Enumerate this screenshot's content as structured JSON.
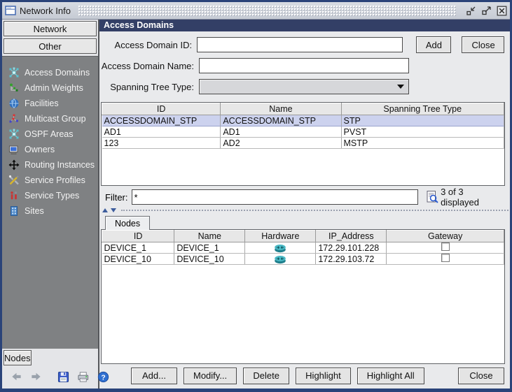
{
  "window": {
    "title": "Network Info"
  },
  "colors": {
    "frame_border": "#2a4379",
    "titlebar_bg": "#ccd1d9",
    "panel_header_bg": "#333f66",
    "sidebar_list_bg": "#7f8183",
    "selected_row_bg": "#ccd2ee",
    "router_icon_teal": "#49b8c4"
  },
  "sidebar": {
    "network_button": "Network",
    "other_button": "Other",
    "items": [
      {
        "label": "Access Domains",
        "icon": "network-hub-icon"
      },
      {
        "label": "Admin Weights",
        "icon": "weights-tree-icon"
      },
      {
        "label": "Facilities",
        "icon": "globe-icon"
      },
      {
        "label": "Multicast Group",
        "icon": "multicast-nodes-icon"
      },
      {
        "label": "OSPF Areas",
        "icon": "network-hub-icon"
      },
      {
        "label": "Owners",
        "icon": "computer-icon"
      },
      {
        "label": "Routing Instances",
        "icon": "cross-arrows-icon"
      },
      {
        "label": "Service Profiles",
        "icon": "tools-icon"
      },
      {
        "label": "Service Types",
        "icon": "service-type-icon"
      },
      {
        "label": "Sites",
        "icon": "building-icon"
      }
    ],
    "nodes_button": "Nodes"
  },
  "main": {
    "header": "Access Domains",
    "form": {
      "id_label": "Access Domain ID:",
      "id_value": "",
      "name_label": "Access Domain Name:",
      "name_value": "",
      "stp_label": "Spanning Tree Type:",
      "stp_value": "",
      "add_button": "Add",
      "close_button": "Close"
    },
    "domains_table": {
      "columns": [
        "ID",
        "Name",
        "Spanning Tree Type"
      ],
      "rows": [
        [
          "ACCESSDOMAIN_STP",
          "ACCESSDOMAIN_STP",
          "STP"
        ],
        [
          "AD1",
          "AD1",
          "PVST"
        ],
        [
          "123",
          "AD2",
          "MSTP"
        ]
      ],
      "selected_row_index": 0
    },
    "filter": {
      "label": "Filter:",
      "value": "*",
      "status": "3 of 3 displayed"
    },
    "nodes_panel": {
      "tab_label": "Nodes",
      "columns": [
        "ID",
        "Name",
        "Hardware",
        "IP_Address",
        "Gateway"
      ],
      "rows": [
        {
          "id": "DEVICE_1",
          "name": "DEVICE_1",
          "hardware": "router-icon",
          "ip": "172.29.101.228",
          "gateway_checked": false
        },
        {
          "id": "DEVICE_10",
          "name": "DEVICE_10",
          "hardware": "router-icon",
          "ip": "172.29.103.72",
          "gateway_checked": false
        }
      ]
    },
    "footer": {
      "add": "Add...",
      "modify": "Modify...",
      "delete": "Delete",
      "highlight": "Highlight",
      "highlight_all": "Highlight All",
      "close": "Close"
    }
  }
}
